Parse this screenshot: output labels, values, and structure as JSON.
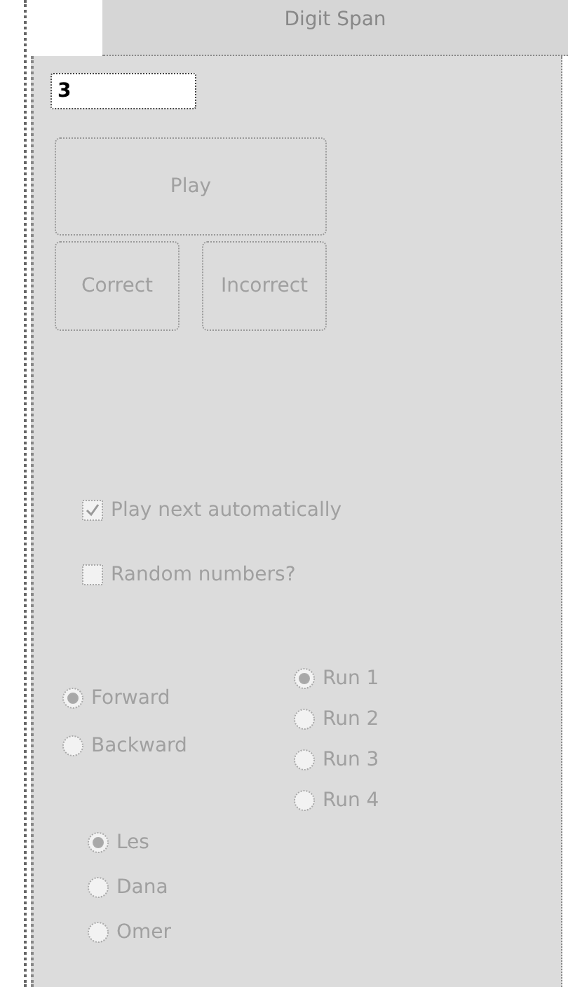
{
  "tab": {
    "label": "Digit Span",
    "selected": true
  },
  "field": {
    "value": "3"
  },
  "play_button": {
    "label": "Play",
    "disabled": true
  },
  "answer_buttons": [
    {
      "label": "Correct",
      "disabled": true
    },
    {
      "label": "Incorrect",
      "disabled": true
    }
  ],
  "checkboxes": [
    {
      "label": "Play next automatically",
      "checked": true,
      "disabled": true
    },
    {
      "label": "Random numbers?",
      "checked": false,
      "disabled": true
    }
  ],
  "direction": [
    {
      "label": "Forward",
      "selected": true,
      "disabled": true
    },
    {
      "label": "Backward",
      "selected": false,
      "disabled": true
    }
  ],
  "runs": [
    {
      "label": "Run 1",
      "selected": true,
      "disabled": true
    },
    {
      "label": "Run 2",
      "selected": false,
      "disabled": true
    },
    {
      "label": "Run 3",
      "selected": false,
      "disabled": true
    },
    {
      "label": "Run 4",
      "selected": false,
      "disabled": true
    }
  ],
  "people": [
    {
      "label": "Les",
      "selected": true,
      "disabled": true
    },
    {
      "label": "Dana",
      "selected": false,
      "disabled": true
    },
    {
      "label": "Omer",
      "selected": false,
      "disabled": true
    }
  ]
}
